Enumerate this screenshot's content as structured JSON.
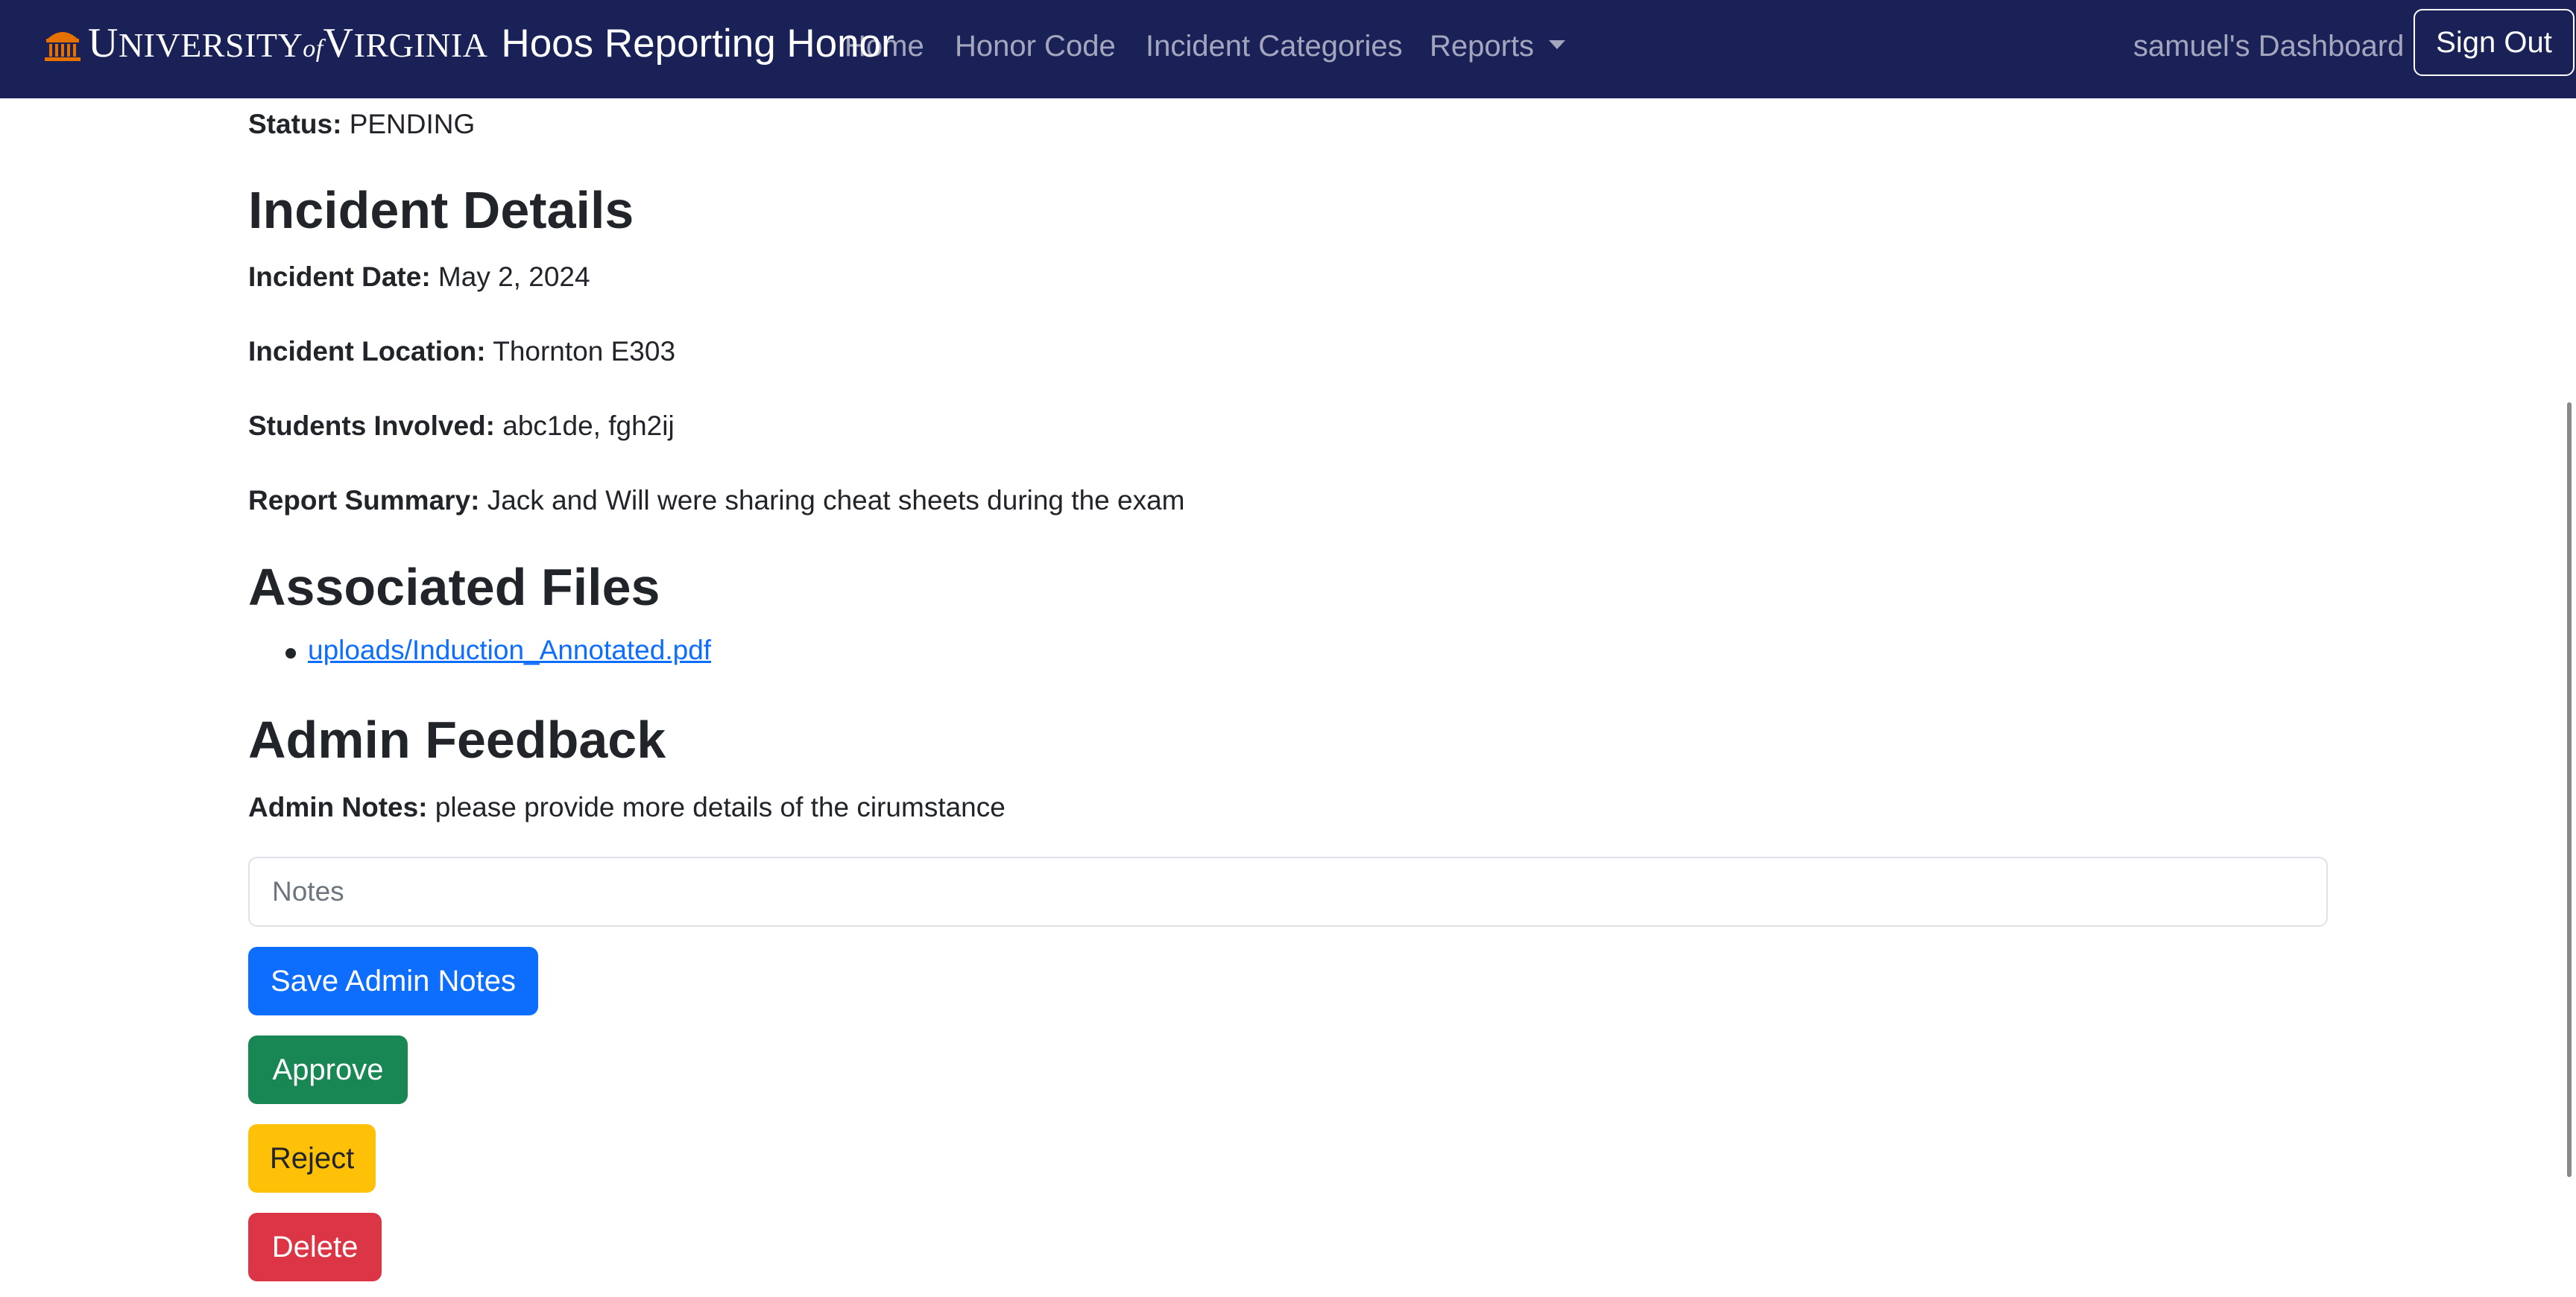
{
  "brand": {
    "logo_big1": "U",
    "logo_small1": "NIVERSITY",
    "logo_of": "of",
    "logo_big2": "V",
    "logo_small2": "IRGINIA",
    "title": "Hoos Reporting Honor"
  },
  "nav": {
    "home": "Home",
    "honor_code": "Honor Code",
    "incident_categories": "Incident Categories",
    "reports": "Reports",
    "dashboard": "samuel's Dashboard",
    "sign_out": "Sign Out"
  },
  "report": {
    "status_label": "Status:",
    "status_value": "PENDING",
    "details_heading": "Incident Details",
    "date_label": "Incident Date:",
    "date_value": "May 2, 2024",
    "location_label": "Incident Location:",
    "location_value": "Thornton E303",
    "students_label": "Students Involved:",
    "students_value": "abc1de, fgh2ij",
    "summary_label": "Report Summary:",
    "summary_value": "Jack and Will were sharing cheat sheets during the exam"
  },
  "files": {
    "heading": "Associated Files",
    "items": [
      "uploads/Induction_Annotated.pdf"
    ]
  },
  "admin": {
    "heading": "Admin Feedback",
    "notes_label": "Admin Notes:",
    "notes_value": "please provide more details of the cirumstance",
    "notes_placeholder": "Notes",
    "save_label": "Save Admin Notes",
    "approve_label": "Approve",
    "reject_label": "Reject",
    "delete_label": "Delete"
  },
  "colors": {
    "navbar": "#1a2157",
    "uva_orange": "#e57200",
    "primary": "#0d6efd",
    "success": "#198754",
    "warning": "#ffc107",
    "danger": "#dc3545"
  },
  "icons": {
    "logo": "rotunda-icon",
    "dropdown": "caret-down-icon"
  }
}
